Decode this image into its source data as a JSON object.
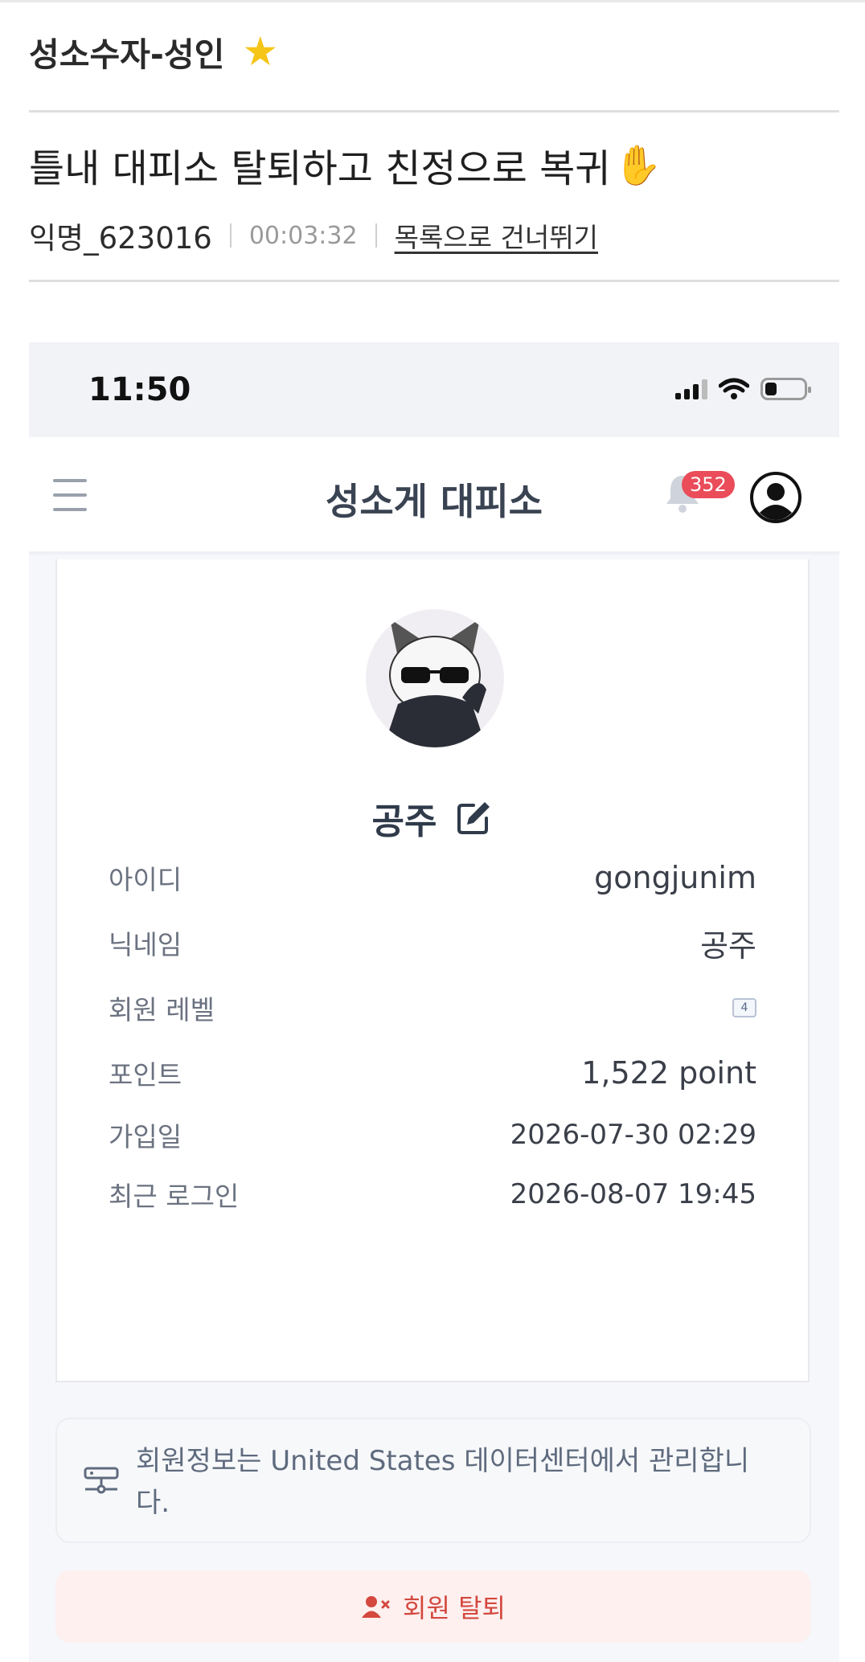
{
  "board": {
    "title": "성소수자-성인",
    "star_icon": "star-icon"
  },
  "post": {
    "title": "틀내 대피소 탈퇴하고 친정으로 복귀",
    "title_emoji": "✋",
    "author": "익명_623016",
    "time": "00:03:32",
    "skip_link": "목록으로 건너뛰기"
  },
  "phone": {
    "status": {
      "clock": "11:50"
    },
    "appbar": {
      "title": "성소게 대피소",
      "notification_count": "352"
    },
    "profile": {
      "nickname": "공주",
      "rows": [
        {
          "label": "아이디",
          "value": "gongjunim"
        },
        {
          "label": "닉네임",
          "value": "공주"
        },
        {
          "label": "회원 레벨",
          "value": "4"
        },
        {
          "label": "포인트",
          "value": "1,522 point"
        },
        {
          "label": "가입일",
          "value": "2026-07-30 02:29"
        },
        {
          "label": "최근 로그인",
          "value": "2026-08-07 19:45"
        }
      ]
    },
    "notice": "회원정보는 United States 데이터센터에서 관리합니다.",
    "withdraw_label": "회원 탈퇴"
  },
  "colors": {
    "badge": "#ea4c5a",
    "withdraw_text": "#d4483f",
    "withdraw_bg": "#fdf0ef",
    "star": "#f5c518"
  }
}
